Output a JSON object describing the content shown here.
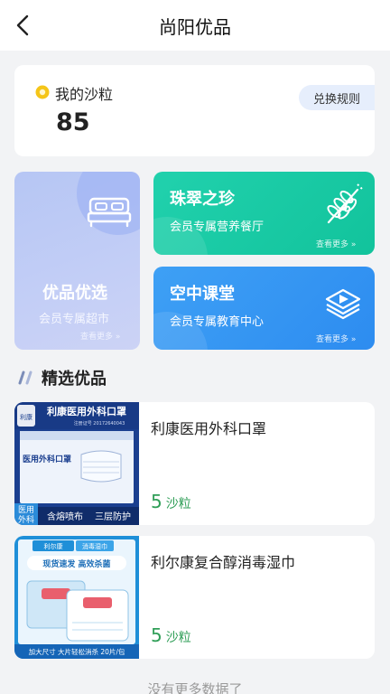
{
  "header": {
    "title": "尚阳优品"
  },
  "points": {
    "label": "我的沙粒",
    "value": "85",
    "exchange_label": "兑换规则"
  },
  "tiles": {
    "mall": {
      "title": "优品优选",
      "subtitle": "会员专属超市",
      "more": "查看更多 »"
    },
    "food": {
      "title": "珠翠之珍",
      "subtitle": "会员专属营养餐厅",
      "more": "查看更多 »"
    },
    "school": {
      "title": "空中课堂",
      "subtitle": "会员专属教育中心",
      "more": "查看更多 »"
    }
  },
  "section": {
    "title": "精选优品"
  },
  "products": [
    {
      "name": "利康医用外科口罩",
      "price": "5",
      "unit": "沙粒",
      "thumb": {
        "brand": "利康",
        "title": "利康医用外科口罩",
        "reg": "注册证号 20172640043",
        "pack_title": "医用外科口罩",
        "badge_line1": "医用",
        "badge_line2": "外科",
        "feature1": "含熔喷布",
        "feature2": "三层防护"
      }
    },
    {
      "name": "利尔康复合醇消毒湿巾",
      "price": "5",
      "unit": "沙粒",
      "thumb": {
        "brand": "利尔康",
        "tag": "消毒湿巾",
        "slogan": "现货速发 高效杀菌",
        "bottom": "加大尺寸 大片轻松消杀 20片/包"
      }
    }
  ],
  "footer": {
    "text": "没有更多数据了"
  },
  "colors": {
    "green_tile": "#1ecaa4",
    "blue_tile": "#3596f2",
    "mall_tile": "#bcc9f4",
    "price": "#2f9e57",
    "coin": "#f5c518"
  }
}
